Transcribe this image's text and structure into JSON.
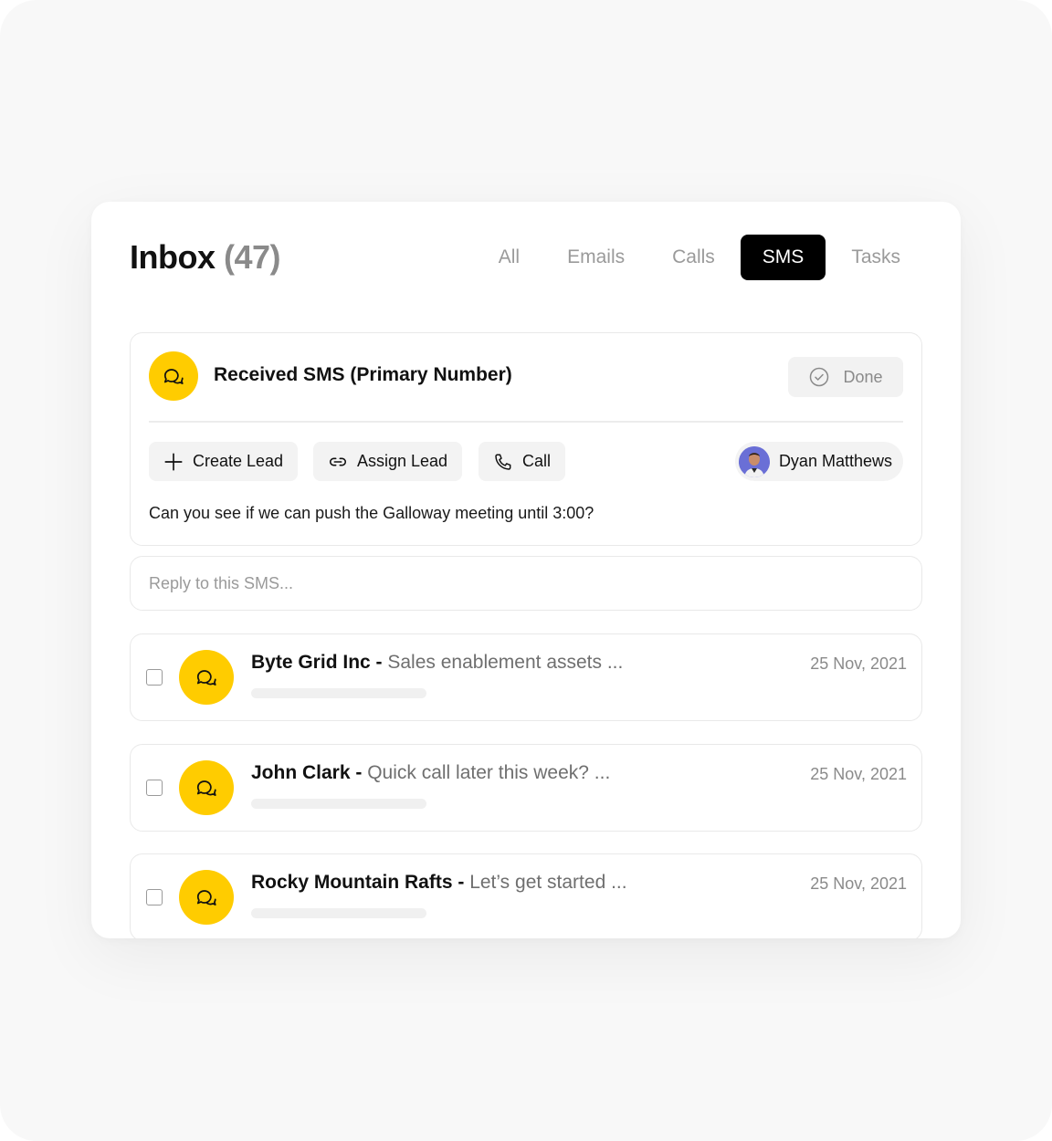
{
  "inbox": {
    "title": "Inbox",
    "count": "(47)",
    "tabs": [
      {
        "label": "All",
        "active": false
      },
      {
        "label": "Emails",
        "active": false
      },
      {
        "label": "Calls",
        "active": false
      },
      {
        "label": "SMS",
        "active": true
      },
      {
        "label": "Tasks",
        "active": false
      }
    ]
  },
  "sms": {
    "title": "Received SMS (Primary Number)",
    "done_label": "Done",
    "actions": {
      "create_lead": "Create Lead",
      "assign_lead": "Assign Lead",
      "call": "Call"
    },
    "user_name": "Dyan Matthews",
    "message": "Can you see if we can push the Galloway meeting until 3:00?",
    "reply_placeholder": "Reply to this SMS..."
  },
  "messages": [
    {
      "sender": "Byte Grid Inc",
      "separator": " - ",
      "subject": "Sales enablement assets ...",
      "date": "25 Nov, 2021"
    },
    {
      "sender": "John Clark",
      "separator": " - ",
      "subject": "Quick call later this week? ...",
      "date": "25 Nov, 2021"
    },
    {
      "sender": "Rocky Mountain Rafts",
      "separator": " - ",
      "subject": "Let’s get started ...",
      "date": "25 Nov, 2021"
    }
  ],
  "colors": {
    "accent_yellow": "#ffcc00",
    "active_tab": "#000000",
    "muted_text": "#8a8a8a"
  },
  "icons": {
    "sms": "chat-bubbles-icon",
    "done": "check-circle-icon",
    "create_lead": "plus-icon",
    "assign_lead": "link-icon",
    "call": "phone-icon"
  }
}
